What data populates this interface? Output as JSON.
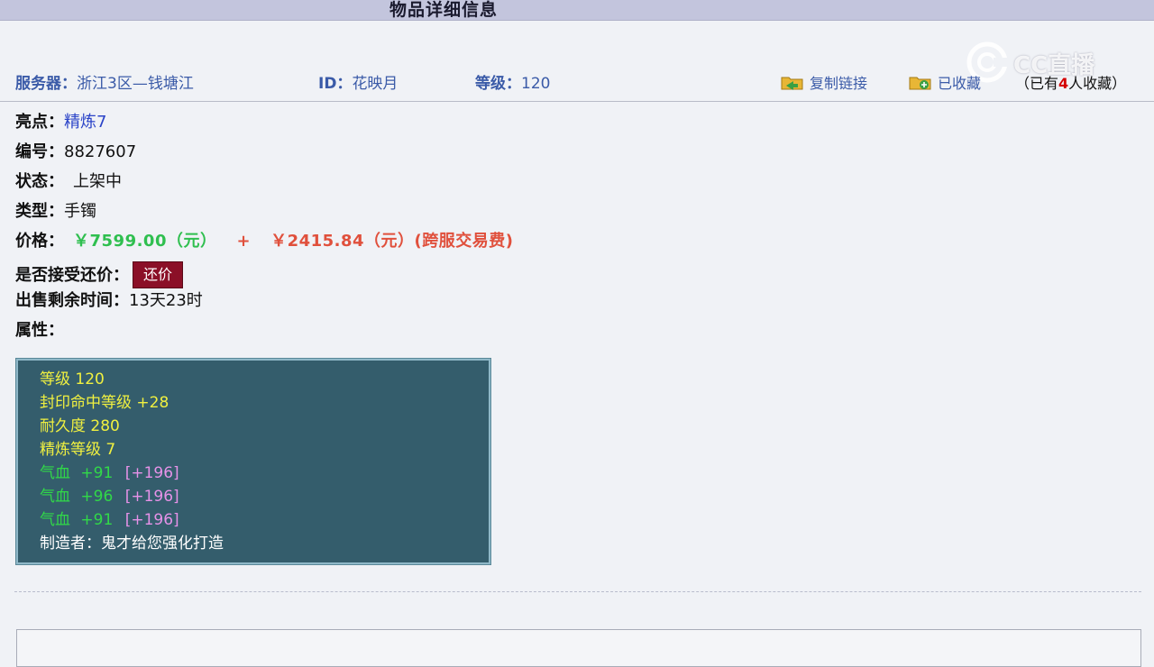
{
  "header": {
    "title": "物品详细信息"
  },
  "info": {
    "server_label": "服务器：",
    "server_value": "浙江3区—钱塘江",
    "id_label": "ID：",
    "id_value": "花映月",
    "level_label": "等级：",
    "level_value": "120",
    "copy_link": "复制链接",
    "favorited": "已收藏",
    "collect_prefix": "（已有",
    "collect_count": "4",
    "collect_suffix": "人收藏）"
  },
  "details": {
    "highlight_label": "亮点：",
    "highlight_value": "精炼7",
    "number_label": "编号：",
    "number_value": "8827607",
    "status_label": "状态：",
    "status_value": "上架中",
    "type_label": "类型：",
    "type_value": "手镯",
    "price_label": "价格：",
    "price_main": "￥7599.00（元）",
    "price_plus": "+",
    "price_fee": "￥2415.84（元）(跨服交易费)",
    "bargain_label": "是否接受还价：",
    "bargain_button": "还价",
    "remain_label": "出售剩余时间：",
    "remain_value": "13天23时",
    "attr_label": "属性："
  },
  "attributes": {
    "level": "等级 120",
    "seal_level": "封印命中等级 +28",
    "durability": "耐久度 280",
    "refine": "精炼等级 7",
    "hp_label": "气血",
    "hp1_val": "+91",
    "hp1_bonus": "[+196]",
    "hp2_val": "+96",
    "hp2_bonus": "[+196]",
    "hp3_val": "+91",
    "hp3_bonus": "[+196]",
    "maker": "制造者：鬼才给您强化打造"
  },
  "watermark": {
    "text": "CC直播",
    "icon": "cc-logo-icon"
  },
  "icons": {
    "copy": "folder-arrow-icon",
    "favorite": "folder-plus-icon"
  },
  "colors": {
    "price_green": "#2fbf4f",
    "price_red": "#e0503c",
    "button_bg": "#8b1027",
    "attr_bg": "#345d6c",
    "label_blue": "#3b5ba8"
  }
}
